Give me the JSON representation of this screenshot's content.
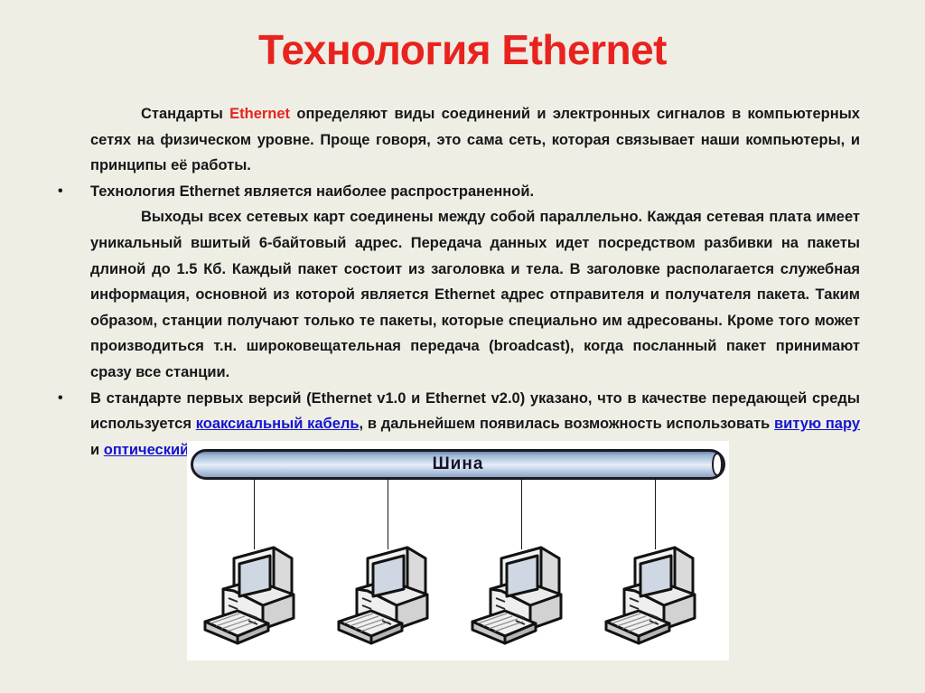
{
  "slide": {
    "background_color": "#eeeee4",
    "title": "Технология Ethernet",
    "title_color": "#e8231f",
    "text_color": "#17171a",
    "link_color": "#1414d2"
  },
  "paragraphs": [
    {
      "bullet": "",
      "has_bullet": false,
      "indent_first_line": true,
      "segments": [
        {
          "text": "Стандарты ",
          "style": "normal"
        },
        {
          "text": "Ethernet",
          "style": "red"
        },
        {
          "text": " определяют виды соединений и электронных сигналов в компьютерных сетях на физическом уровне. Проще говоря, это сама сеть, которая связывает наши компьютеры, и принципы её работы.",
          "style": "normal"
        }
      ]
    },
    {
      "bullet": "•",
      "has_bullet": true,
      "indent_first_line": false,
      "segments": [
        {
          "text": "Технология  Ethernet  является наиболее распространенной.",
          "style": "normal"
        }
      ]
    },
    {
      "bullet": "",
      "has_bullet": false,
      "indent_first_line": true,
      "segments": [
        {
          "text": "Выходы всех сетевых карт соединены между собой параллельно. Каждая сетевая плата имеет уникальный вшитый 6-байтовый адрес. Передача данных идет посредством разбивки на пакеты длиной до 1.5 Кб. Каждый пакет состоит из заголовка и тела. В заголовке располагается служебная информация, основной из которой является Ethernet адрес отправителя и получателя пакета. Таким образом, станции получают только те пакеты, которые специально им адресованы. Кроме того может производиться т.н. широковещательная передача (broadcast), когда посланный пакет принимают сразу все станции.",
          "style": "normal"
        }
      ]
    },
    {
      "bullet": "•",
      "has_bullet": true,
      "indent_first_line": false,
      "segments": [
        {
          "text": " В стандарте первых версий (Ethernet v1.0 и Ethernet v2.0) указано, что в качестве передающей среды используется ",
          "style": "normal"
        },
        {
          "text": "коаксиальный кабель",
          "style": "link"
        },
        {
          "text": ", в дальнейшем появилась возможность использовать ",
          "style": "normal"
        },
        {
          "text": "витую пару",
          "style": "link"
        },
        {
          "text": " и ",
          "style": "normal"
        },
        {
          "text": "оптический кабель",
          "style": "link"
        },
        {
          "text": ".",
          "style": "normal"
        }
      ]
    }
  ],
  "diagram": {
    "panel_background": "#ffffff",
    "bus_label": "Шина",
    "bus_label_color": "#14142b",
    "bus_outline_color": "#1b1b22",
    "drop_line_color": "#1a1a1a",
    "node_count": 4,
    "node_positions_x": [
      70,
      218,
      366,
      514
    ],
    "drop_positions_x": [
      70,
      218,
      366,
      514
    ],
    "node_type": "desktop-computer"
  }
}
